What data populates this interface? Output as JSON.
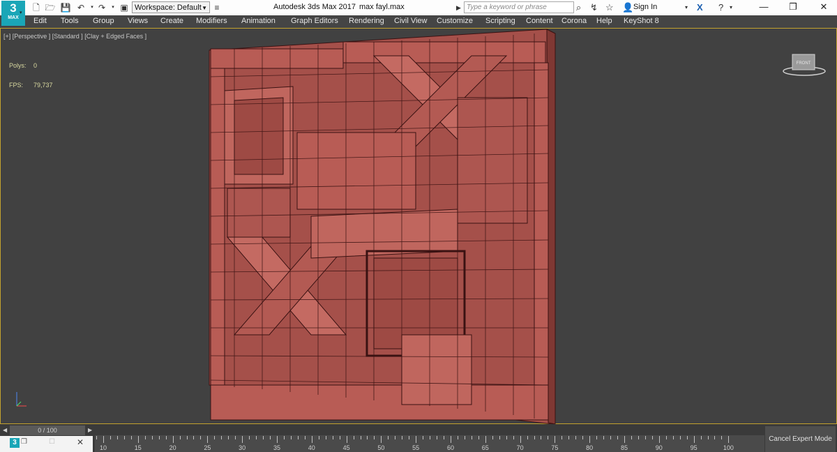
{
  "app": {
    "logo_number": "3",
    "logo_text": "MAX",
    "workspace_label": "Workspace: Default",
    "title": "Autodesk 3ds Max 2017",
    "file_name": "max fayl.max",
    "search_placeholder": "Type a keyword or phrase",
    "sign_in": "Sign In"
  },
  "menu": [
    "Edit",
    "Tools",
    "Group",
    "Views",
    "Create",
    "Modifiers",
    "Animation",
    "Graph Editors",
    "Rendering",
    "Civil View",
    "Customize",
    "Scripting",
    "Content",
    "Corona",
    "Help",
    "KeyShot 8"
  ],
  "viewport": {
    "label": "[+] [Perspective ] [Standard ] [Clay + Edged Faces ]",
    "polys_label": "Polys:",
    "polys_value": "0",
    "fps_label": "FPS:",
    "fps_value": "79,737",
    "viewcube_face": "FRONT",
    "object_color": "#b85c55",
    "edge_color": "#3a1212"
  },
  "timeline": {
    "frame_display": "0 / 100",
    "ticks": [
      "10",
      "15",
      "20",
      "25",
      "30",
      "35",
      "40",
      "45",
      "50",
      "55",
      "60",
      "65",
      "70",
      "75",
      "80",
      "85",
      "90",
      "95",
      "100"
    ],
    "cancel_expert": "Cancel Expert Mode"
  },
  "colors": {
    "viewport_border": "#c3a22e",
    "menubar": "#454545"
  }
}
